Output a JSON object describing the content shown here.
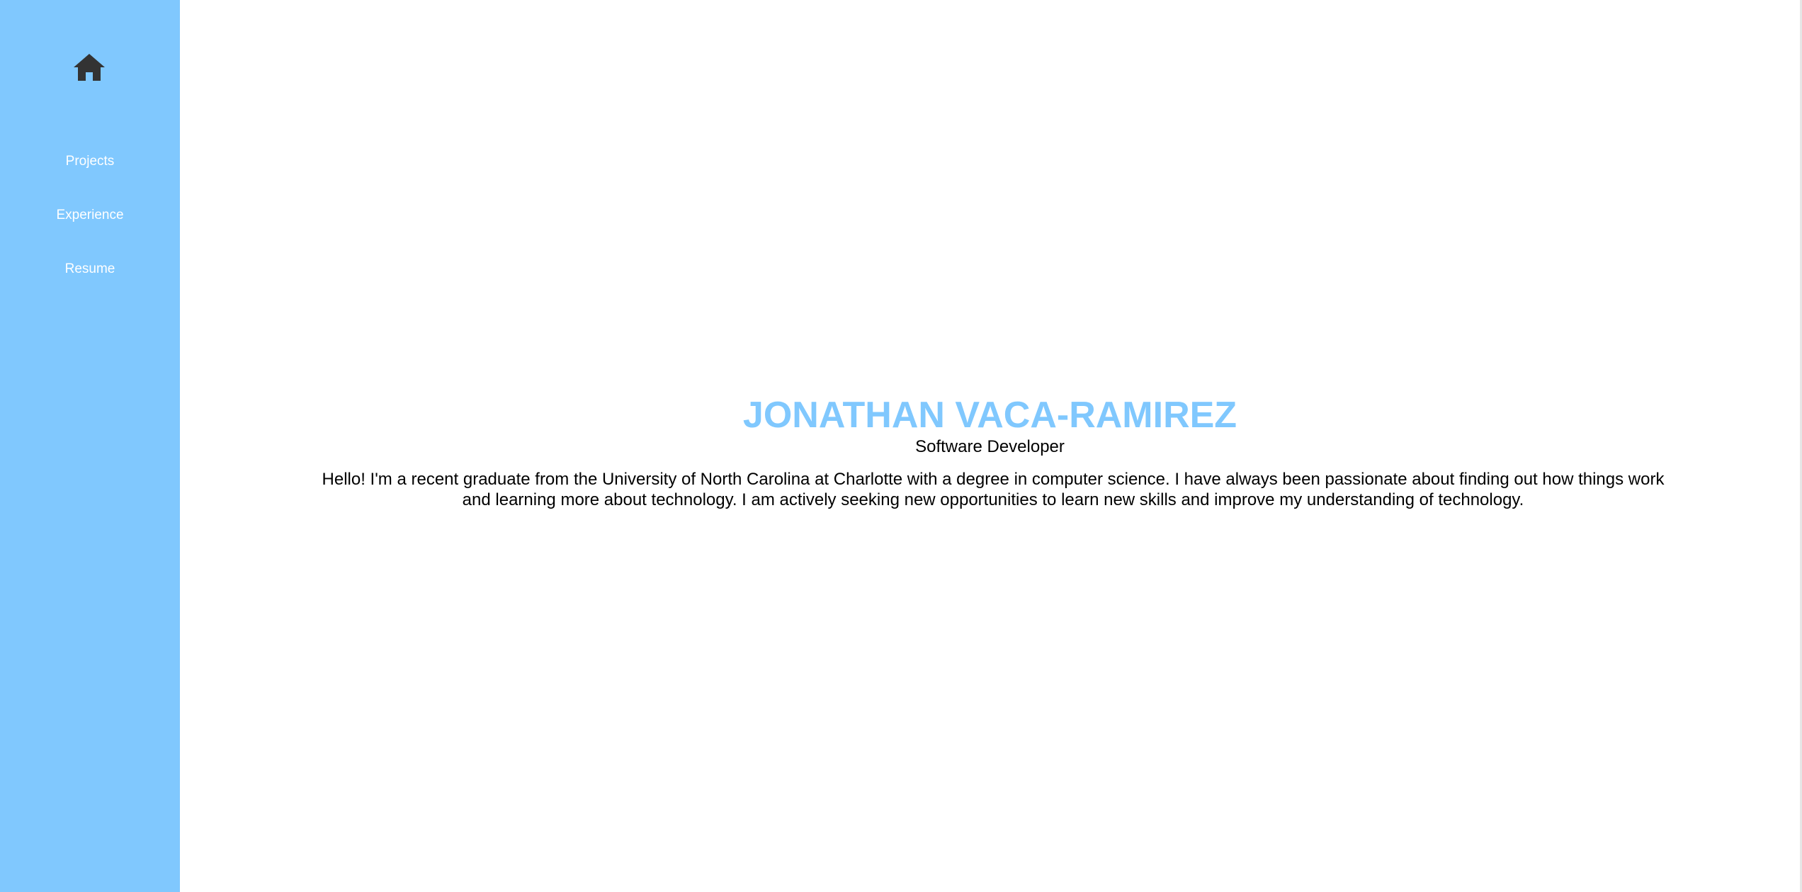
{
  "sidebar": {
    "background": "#80c8fe",
    "home_icon": "home-icon",
    "items": [
      {
        "label": "Projects"
      },
      {
        "label": "Experience"
      },
      {
        "label": "Resume"
      }
    ]
  },
  "main": {
    "name": "JONATHAN VACA-RAMIREZ",
    "name_color": "#80c8fe",
    "role": "Software Developer",
    "bio": "Hello! I'm a recent graduate from the University of North Carolina at Charlotte with a degree in computer science. I have always been passionate about finding out how things work and learning more about technology. I am actively seeking new opportunities to learn new skills and improve my understanding of technology."
  }
}
